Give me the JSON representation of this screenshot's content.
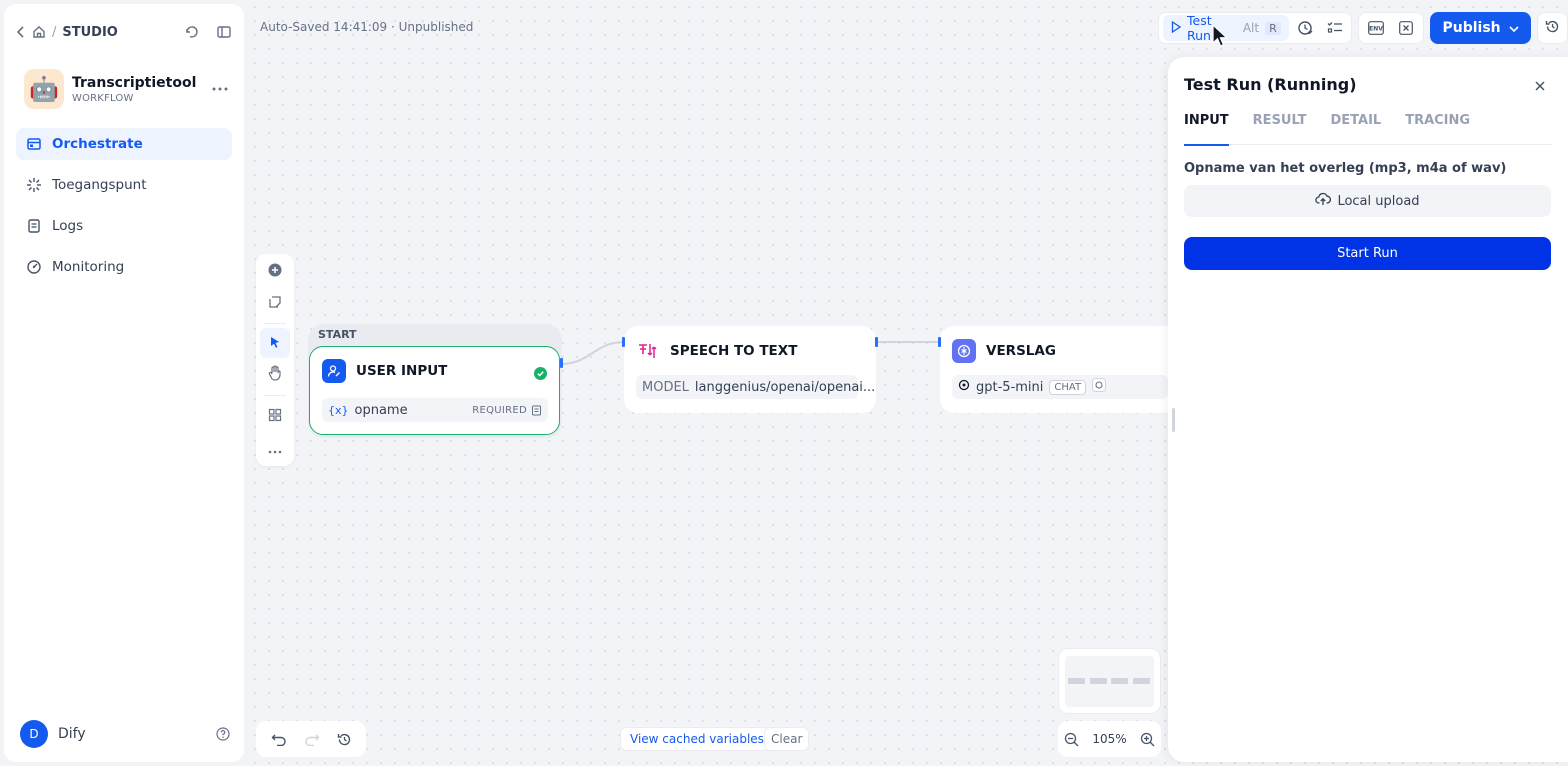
{
  "sidebar": {
    "section": "STUDIO",
    "app": {
      "name": "Transcriptietool",
      "kind": "WORKFLOW",
      "emoji": "🤖"
    },
    "nav": [
      {
        "label": "Orchestrate",
        "icon": "layout-icon",
        "active": true
      },
      {
        "label": "Toegangspunt",
        "icon": "access-point-icon",
        "active": false
      },
      {
        "label": "Logs",
        "icon": "logs-icon",
        "active": false
      },
      {
        "label": "Monitoring",
        "icon": "monitoring-icon",
        "active": false
      }
    ],
    "user": {
      "initial": "D",
      "name": "Dify"
    }
  },
  "canvas": {
    "autosave": "Auto-Saved 14:41:09 · Unpublished",
    "start_label": "START",
    "nodes": {
      "user_input": {
        "title": "USER INPUT",
        "var_prefix": "{x}",
        "var": "opname",
        "required": "REQUIRED"
      },
      "speech": {
        "title": "SPEECH TO TEXT",
        "model_label": "MODEL",
        "model": "langgenius/openai/openai..."
      },
      "verslag": {
        "title": "VERSLAG",
        "model": "gpt-5-mini",
        "badge": "CHAT"
      }
    },
    "cache_button": "View cached variables",
    "clear_button": "Clear",
    "zoom": "105%"
  },
  "toolbar": {
    "test_run": "Test Run",
    "shortcut_mod": "Alt",
    "shortcut_key": "R",
    "publish": "Publish"
  },
  "panel": {
    "title": "Test Run (Running)",
    "tabs": [
      "INPUT",
      "RESULT",
      "DETAIL",
      "TRACING"
    ],
    "field_label": "Opname van het overleg (mp3, m4a of wav)",
    "upload": "Local upload",
    "start": "Start Run"
  },
  "colors": {
    "accent": "#155aef",
    "success": "#17b26a",
    "start_run": "#0033e6"
  }
}
